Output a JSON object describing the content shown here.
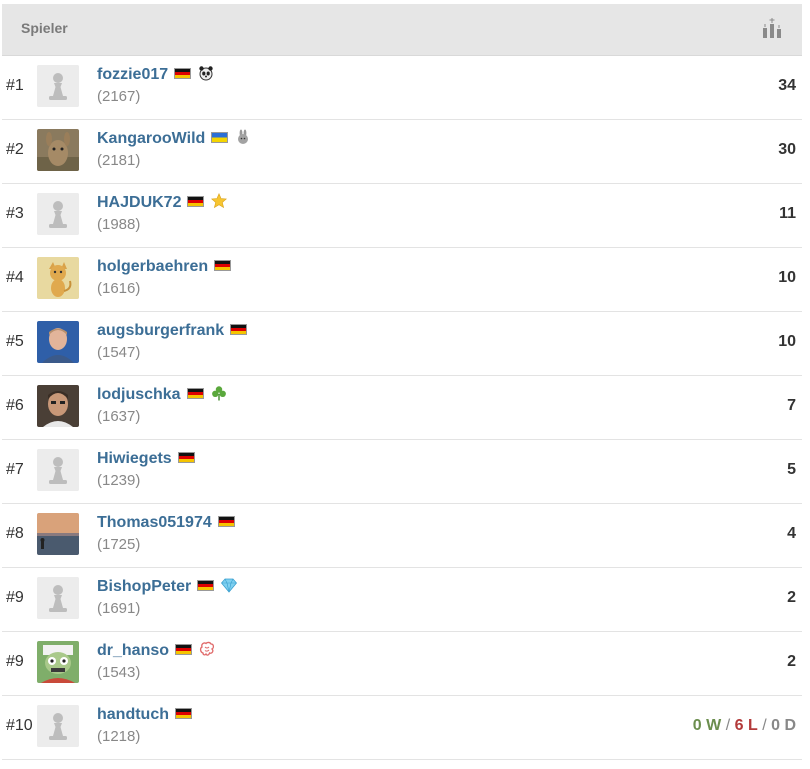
{
  "header": {
    "title": "Spieler",
    "icon": "trophy-icon"
  },
  "rows": [
    {
      "rank": "#1",
      "name": "fozzie017",
      "rating": "(2167)",
      "flag": "de",
      "badge": "panda-icon",
      "points": "34",
      "avatar": "pawn"
    },
    {
      "rank": "#2",
      "name": "KangarooWild",
      "rating": "(2181)",
      "flag": "ua",
      "badge": "rabbit-icon",
      "points": "30",
      "avatar": "kangaroo-photo"
    },
    {
      "rank": "#3",
      "name": "HAJDUK72",
      "rating": "(1988)",
      "flag": "de",
      "badge": "star-icon",
      "points": "11",
      "avatar": "pawn"
    },
    {
      "rank": "#4",
      "name": "holgerbaehren",
      "rating": "(1616)",
      "flag": "de",
      "badge": "",
      "points": "10",
      "avatar": "cat-drawing"
    },
    {
      "rank": "#5",
      "name": "augsburgerfrank",
      "rating": "(1547)",
      "flag": "de",
      "badge": "",
      "points": "10",
      "avatar": "man-photo-blue"
    },
    {
      "rank": "#6",
      "name": "lodjuschka",
      "rating": "(1637)",
      "flag": "de",
      "badge": "clover-icon",
      "points": "7",
      "avatar": "man-photo"
    },
    {
      "rank": "#7",
      "name": "Hiwiegets",
      "rating": "(1239)",
      "flag": "de",
      "badge": "",
      "points": "5",
      "avatar": "pawn"
    },
    {
      "rank": "#8",
      "name": "Thomas051974",
      "rating": "(1725)",
      "flag": "de",
      "badge": "",
      "points": "4",
      "avatar": "sunset-photo"
    },
    {
      "rank": "#9",
      "name": "BishopPeter",
      "rating": "(1691)",
      "flag": "de",
      "badge": "diamond-icon",
      "points": "2",
      "avatar": "pawn"
    },
    {
      "rank": "#9",
      "name": "dr_hanso",
      "rating": "(1543)",
      "flag": "de",
      "badge": "brain-icon",
      "points": "2",
      "avatar": "zombie-drawing"
    },
    {
      "rank": "#10",
      "name": "handtuch",
      "rating": "(1218)",
      "flag": "de",
      "badge": "",
      "points": "",
      "avatar": "pawn",
      "wld": {
        "w": "0 W",
        "l": "6 L",
        "d": "0 D",
        "sep": "/"
      }
    }
  ],
  "colors": {
    "link": "#3c6e96",
    "win": "#6b8e4e",
    "loss": "#b33a3a",
    "header_bg": "#e6e6e6"
  }
}
